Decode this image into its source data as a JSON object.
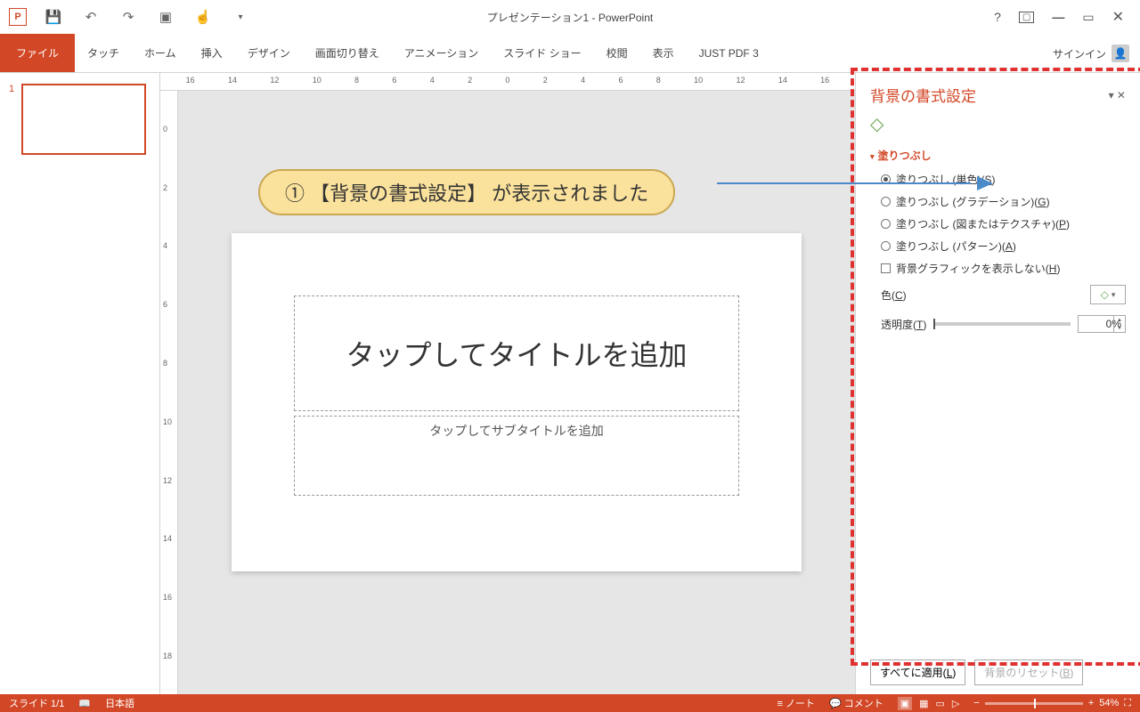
{
  "app": {
    "title": "プレゼンテーション1 - PowerPoint",
    "signin": "サインイン"
  },
  "tabs": {
    "file": "ファイル",
    "touch": "タッチ",
    "home": "ホーム",
    "insert": "挿入",
    "design": "デザイン",
    "transition": "画面切り替え",
    "animation": "アニメーション",
    "slideshow": "スライド ショー",
    "review": "校閲",
    "view": "表示",
    "justpdf": "JUST PDF 3"
  },
  "thumbnails": {
    "n1": "1"
  },
  "callout": {
    "text": "① 【背景の書式設定】 が表示されました"
  },
  "slide": {
    "title_ph": "タップしてタイトルを追加",
    "subtitle_ph": "タップしてサブタイトルを追加"
  },
  "ruler_h": [
    "16",
    "14",
    "12",
    "10",
    "8",
    "6",
    "4",
    "2",
    "0",
    "2",
    "4",
    "6",
    "8",
    "10",
    "12",
    "14",
    "16"
  ],
  "ruler_v": [
    "0",
    "2",
    "4",
    "6",
    "8",
    "10",
    "12",
    "14",
    "16",
    "18"
  ],
  "pane": {
    "title": "背景の書式設定",
    "section": "塗りつぶし",
    "r_solid_a": "塗りつぶし (単色)(",
    "r_solid_u": "S",
    "r_solid_b": ")",
    "r_grad_a": "塗りつぶし (グラデーション)(",
    "r_grad_u": "G",
    "r_grad_b": ")",
    "r_pic_a": "塗りつぶし (図またはテクスチャ)(",
    "r_pic_u": "P",
    "r_pic_b": ")",
    "r_pat_a": "塗りつぶし (パターン)(",
    "r_pat_u": "A",
    "r_pat_b": ")",
    "chk_a": "背景グラフィックを表示しない(",
    "chk_u": "H",
    "chk_b": ")",
    "color_a": "色(",
    "color_u": "C",
    "color_b": ")",
    "trans_a": "透明度(",
    "trans_u": "T",
    "trans_b": ")",
    "trans_val": "0%",
    "apply_a": "すべてに適用(",
    "apply_u": "L",
    "apply_b": ")",
    "reset_a": "背景のリセット(",
    "reset_u": "B",
    "reset_b": ")"
  },
  "status": {
    "slide": "スライド 1/1",
    "lang": "日本語",
    "notes": "ノート",
    "comments": "コメント",
    "zoom": "54%"
  }
}
